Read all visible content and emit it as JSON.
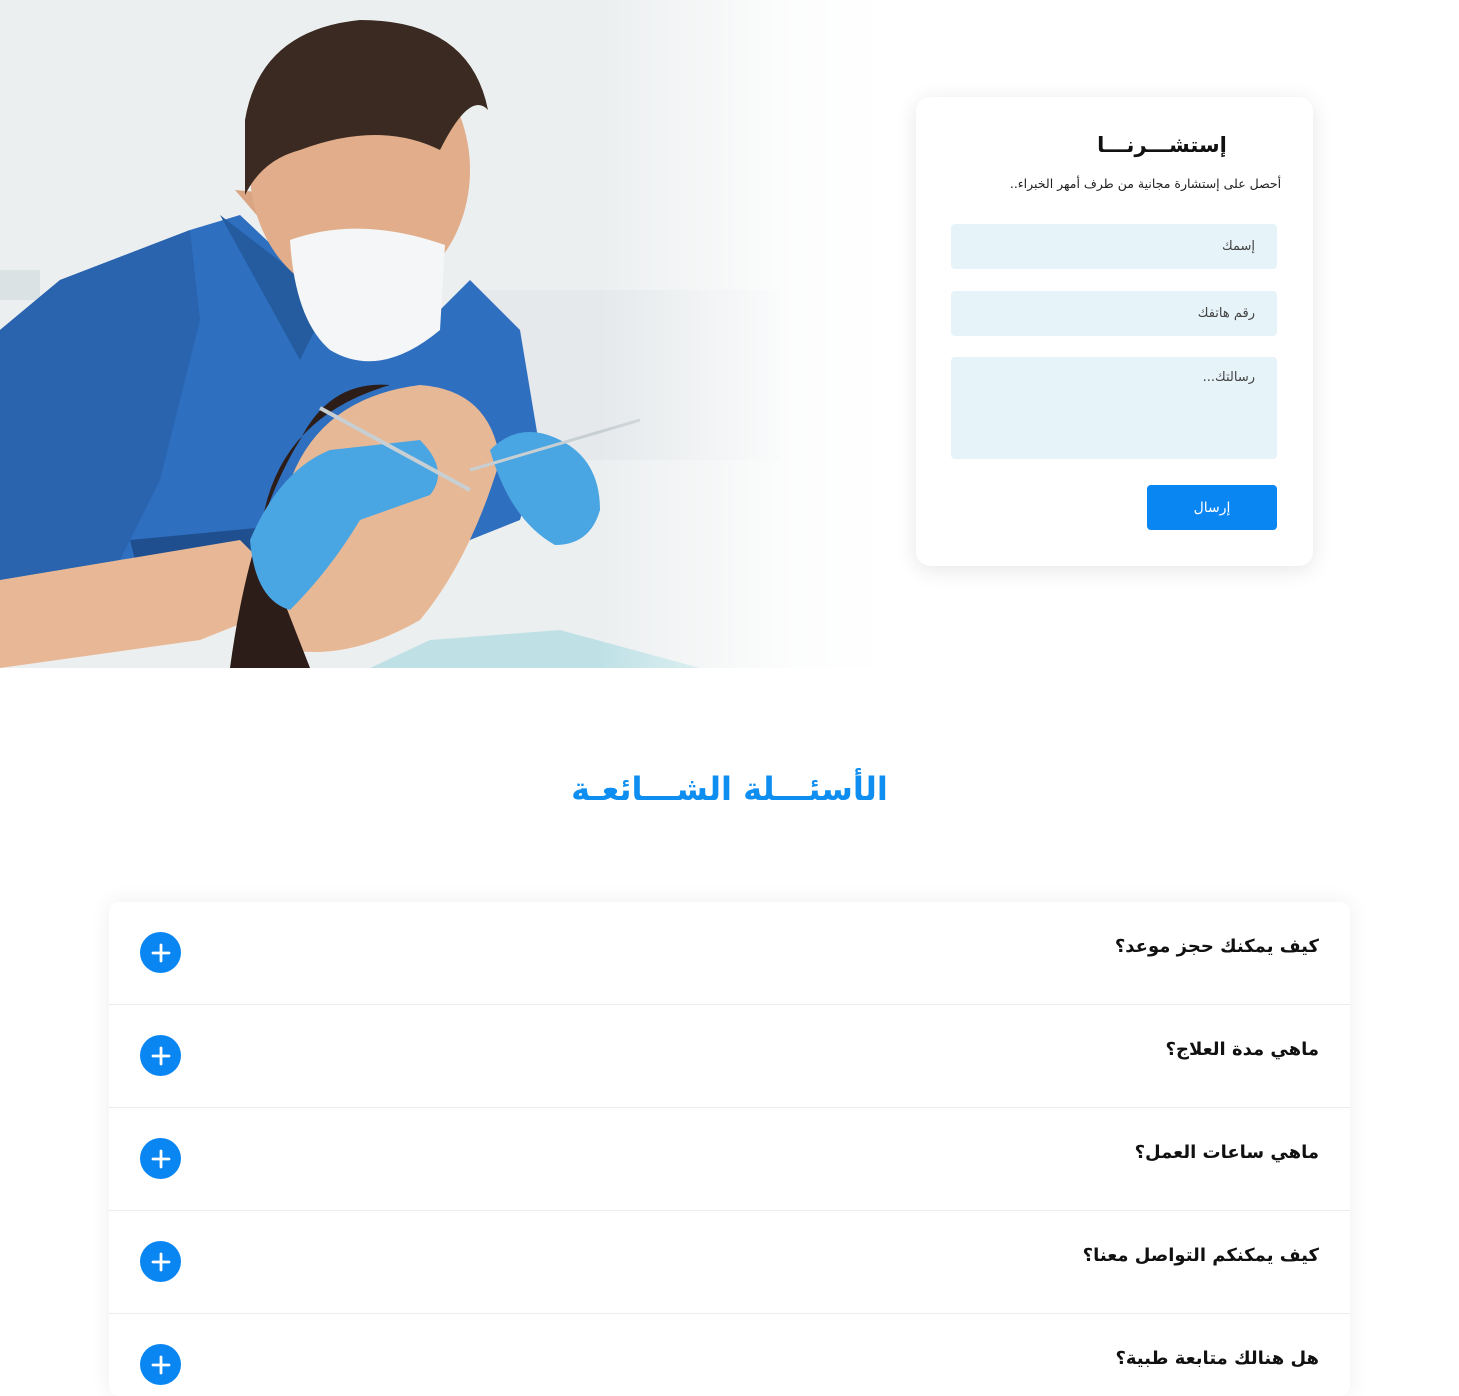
{
  "hero": {
    "image_alt": "dentist-treating-patient-photo"
  },
  "consult_form": {
    "title": "إستشـــرنـــا",
    "subtitle": "أحصل على إستشارة مجانية من طرف أمهر الخبراء..",
    "name_placeholder": "إسمك",
    "phone_placeholder": "رقم هاتفك",
    "message_placeholder": "رسالتك...",
    "submit_label": "إرسال"
  },
  "faq": {
    "title": "الأسئـــلة الشـــائعـة",
    "items": [
      {
        "question": "كيف يمكنك حجز موعد؟"
      },
      {
        "question": "ماهي مدة العلاج؟"
      },
      {
        "question": "ماهي ساعات العمل؟"
      },
      {
        "question": "كيف يمكنكم التواصل معنا؟"
      },
      {
        "question": "هل هنالك متابعة طبية؟"
      }
    ],
    "expand_icon": "plus-icon"
  },
  "colors": {
    "accent": "#0a86f2",
    "title_blue": "#0d8ef0",
    "field_bg": "#e6f3f9"
  }
}
